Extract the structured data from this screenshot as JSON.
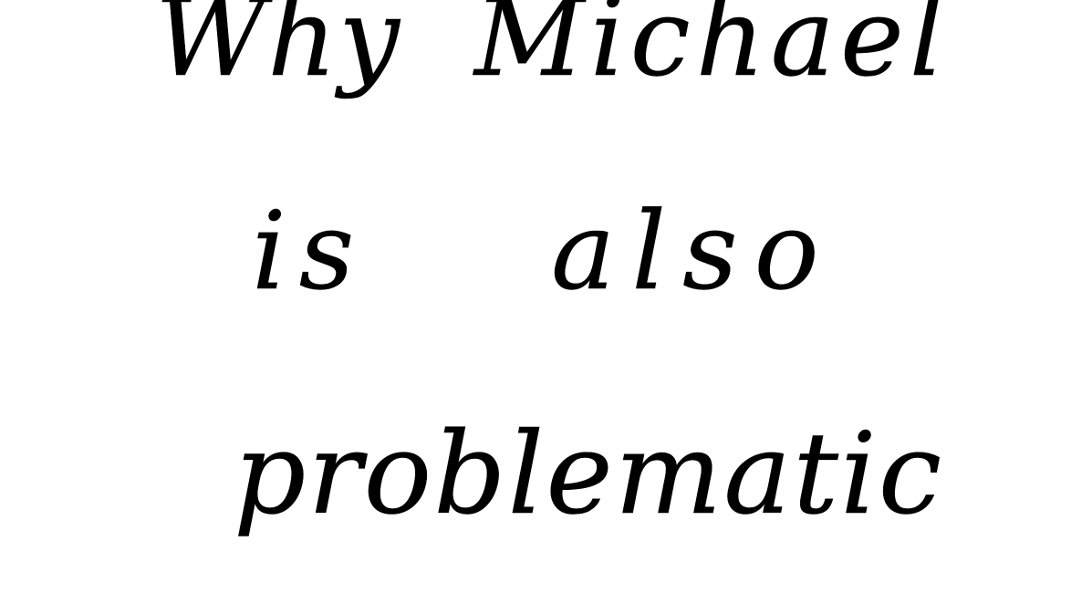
{
  "note": {
    "lines": [
      [
        "Why",
        "Michael"
      ],
      [
        "is",
        "also"
      ],
      [
        "problematic"
      ]
    ],
    "ink_color": "#000000",
    "background_color": "#ffffff"
  }
}
